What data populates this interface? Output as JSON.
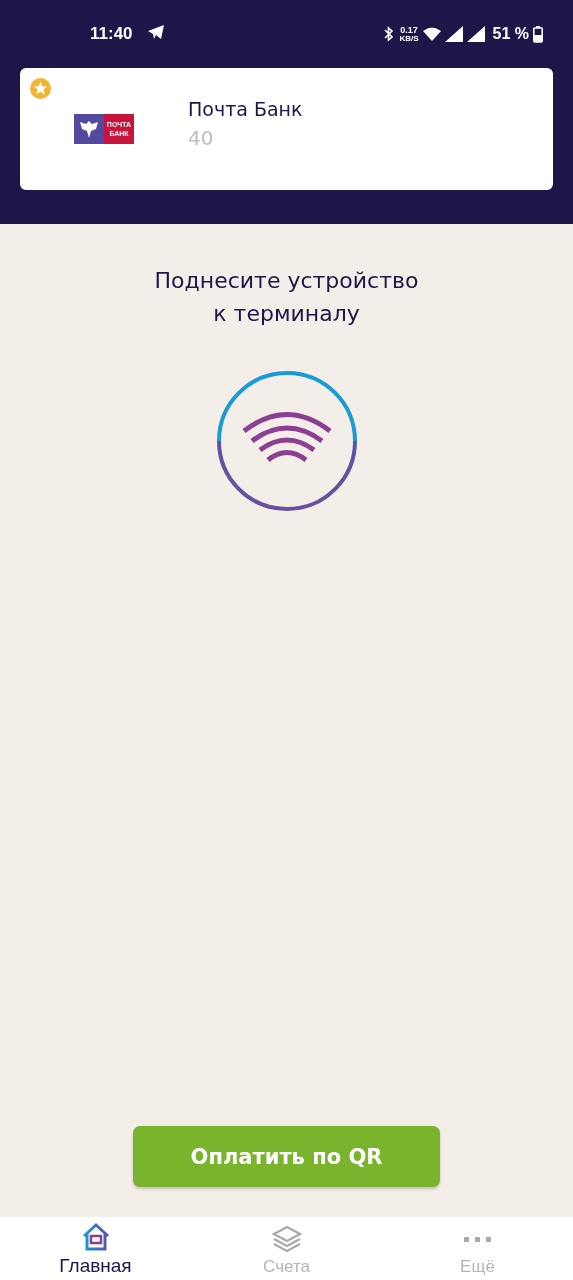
{
  "status_bar": {
    "time": "11:40",
    "network_speed": "0.17",
    "speed_unit": "KB/S",
    "battery": "51 %"
  },
  "card": {
    "favorite": true,
    "logo_text": "ПОЧТА БАНК",
    "name": "Почта Банк",
    "number": "40"
  },
  "prompt": {
    "text": "Поднесите устройство к терминалу"
  },
  "pay_button": {
    "label": "Оплатить по QR"
  },
  "bottom_nav": [
    {
      "kind": "home",
      "label": "Главная",
      "selected": true
    },
    {
      "kind": "accounts",
      "label": "Счета",
      "selected": false
    },
    {
      "kind": "more",
      "label": "Ещё",
      "selected": false
    }
  ]
}
